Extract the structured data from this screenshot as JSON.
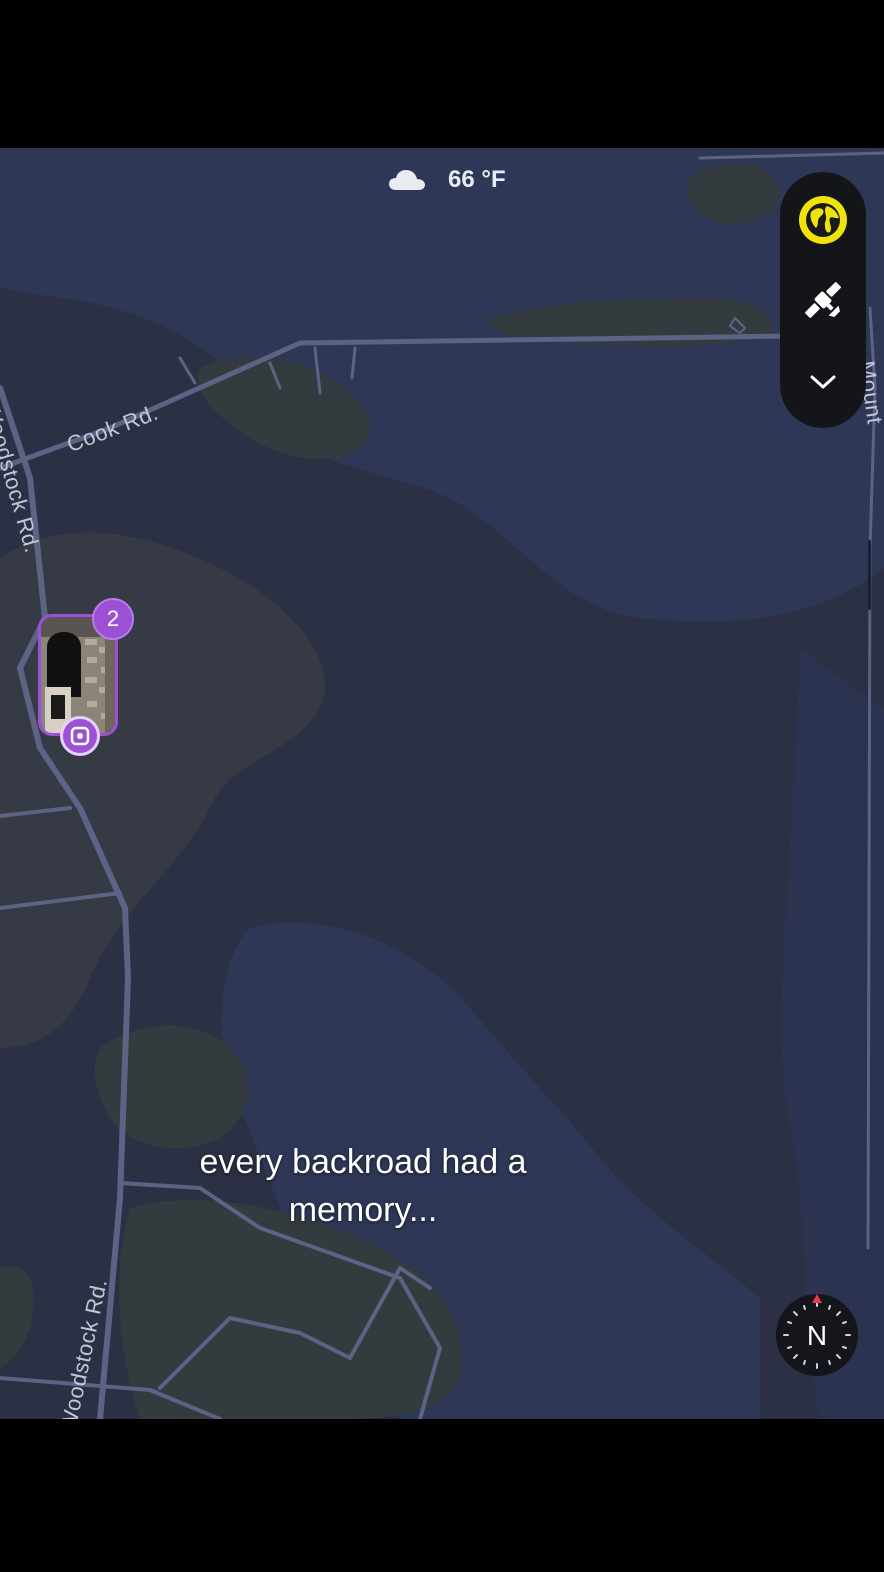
{
  "weather": {
    "icon": "cloud-icon",
    "temperature": "66 °F"
  },
  "map": {
    "road_labels": {
      "cook_rd": "Cook Rd.",
      "woodstock_rd_top": "Woodstock Rd.",
      "woodstock_rd_bottom": "Woodstock Rd.",
      "mount_rd": "Mount"
    },
    "colors": {
      "base": "#2b3044",
      "water": "#2e3756",
      "green": "#343a40",
      "road": "#5c6385",
      "accent": "#9b50d6"
    }
  },
  "layer_controls": {
    "buttons": [
      {
        "icon": "globe-icon",
        "active": true
      },
      {
        "icon": "satellite-icon",
        "active": false
      },
      {
        "icon": "chevron-down-icon",
        "active": false
      }
    ]
  },
  "memory_pin": {
    "count": "2",
    "icon": "memories-icon"
  },
  "caption": {
    "line1": "every backroad had a",
    "line2": "memory..."
  },
  "compass": {
    "label": "N"
  }
}
